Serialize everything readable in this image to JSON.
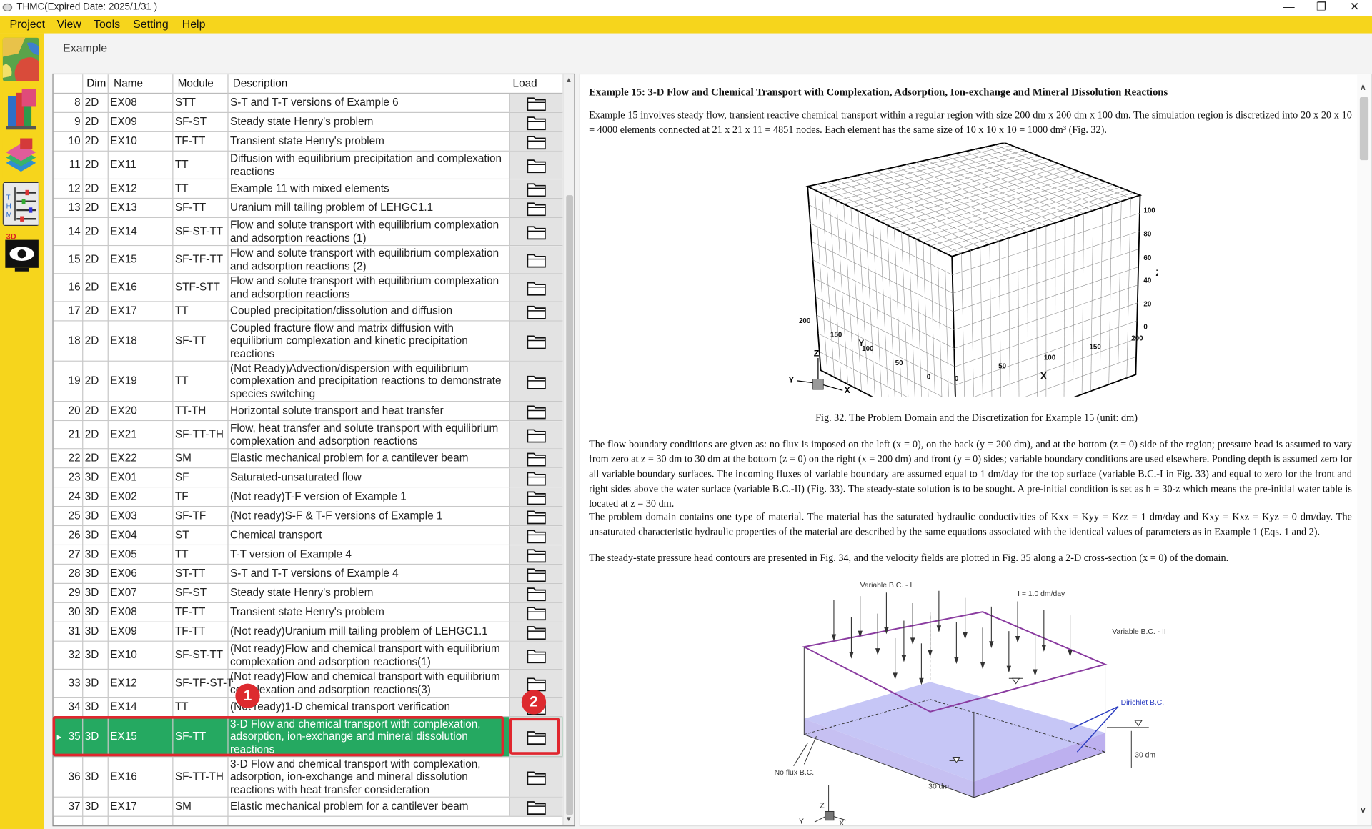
{
  "window": {
    "title": "THMC(Expired Date: 2025/1/31 )"
  },
  "menu": [
    "Project",
    "View",
    "Tools",
    "Setting",
    "Help"
  ],
  "toolbar": [
    "map-tool-icon",
    "books-tool-icon",
    "3d-layers-tool-icon",
    "thmc-panel-tool-icon",
    "3d-viewer-tool-icon"
  ],
  "tab": {
    "label": "Example"
  },
  "grid": {
    "columns": [
      "Dim",
      "Name",
      "Module",
      "Description",
      "Load"
    ],
    "rows": [
      {
        "n": "8",
        "dim": "2D",
        "name": "EX08",
        "module": "STT",
        "desc": "S-T and T-T versions of Example 6"
      },
      {
        "n": "9",
        "dim": "2D",
        "name": "EX09",
        "module": "SF-ST",
        "desc": "Steady state Henry's problem"
      },
      {
        "n": "10",
        "dim": "2D",
        "name": "EX10",
        "module": "TF-TT",
        "desc": "Transient state Henry's problem"
      },
      {
        "n": "11",
        "dim": "2D",
        "name": "EX11",
        "module": "TT",
        "desc": "Diffusion with equilibrium precipitation and complexation reactions"
      },
      {
        "n": "12",
        "dim": "2D",
        "name": "EX12",
        "module": "TT",
        "desc": "Example 11 with mixed elements"
      },
      {
        "n": "13",
        "dim": "2D",
        "name": "EX13",
        "module": "SF-TT",
        "desc": "Uranium mill tailing problem of LEHGC1.1"
      },
      {
        "n": "14",
        "dim": "2D",
        "name": "EX14",
        "module": "SF-ST-TT",
        "desc": "Flow and solute transport with equilibrium complexation and adsorption reactions (1)"
      },
      {
        "n": "15",
        "dim": "2D",
        "name": "EX15",
        "module": "SF-TF-TT",
        "desc": "Flow and solute transport with equilibrium complexation and adsorption reactions (2)"
      },
      {
        "n": "16",
        "dim": "2D",
        "name": "EX16",
        "module": "STF-STT",
        "desc": "Flow and solute transport with equilibrium complexation and adsorption reactions"
      },
      {
        "n": "17",
        "dim": "2D",
        "name": "EX17",
        "module": "TT",
        "desc": "Coupled precipitation/dissolution and diffusion"
      },
      {
        "n": "18",
        "dim": "2D",
        "name": "EX18",
        "module": "SF-TT",
        "desc": "Coupled fracture flow and matrix diffusion with equilibrium complexation and kinetic precipitation reactions"
      },
      {
        "n": "19",
        "dim": "2D",
        "name": "EX19",
        "module": "TT",
        "desc": "(Not Ready)Advection/dispersion with equilibrium complexation and precipitation reactions to demonstrate species switching"
      },
      {
        "n": "20",
        "dim": "2D",
        "name": "EX20",
        "module": "TT-TH",
        "desc": "Horizontal solute transport and heat transfer"
      },
      {
        "n": "21",
        "dim": "2D",
        "name": "EX21",
        "module": "SF-TT-TH",
        "desc": "Flow, heat transfer and solute transport with equilibrium complexation and adsorption reactions"
      },
      {
        "n": "22",
        "dim": "2D",
        "name": "EX22",
        "module": "SM",
        "desc": "Elastic mechanical problem for a cantilever beam"
      },
      {
        "n": "23",
        "dim": "3D",
        "name": "EX01",
        "module": "SF",
        "desc": "Saturated-unsaturated flow"
      },
      {
        "n": "24",
        "dim": "3D",
        "name": "EX02",
        "module": "TF",
        "desc": "(Not ready)T-F version of Example 1"
      },
      {
        "n": "25",
        "dim": "3D",
        "name": "EX03",
        "module": "SF-TF",
        "desc": "(Not ready)S-F & T-F versions of Example 1"
      },
      {
        "n": "26",
        "dim": "3D",
        "name": "EX04",
        "module": "ST",
        "desc": "Chemical transport"
      },
      {
        "n": "27",
        "dim": "3D",
        "name": "EX05",
        "module": "TT",
        "desc": "T-T version of Example 4"
      },
      {
        "n": "28",
        "dim": "3D",
        "name": "EX06",
        "module": "ST-TT",
        "desc": "S-T and T-T versions of Example 4"
      },
      {
        "n": "29",
        "dim": "3D",
        "name": "EX07",
        "module": "SF-ST",
        "desc": "Steady state Henry's problem"
      },
      {
        "n": "30",
        "dim": "3D",
        "name": "EX08",
        "module": "TF-TT",
        "desc": "Transient state Henry's problem"
      },
      {
        "n": "31",
        "dim": "3D",
        "name": "EX09",
        "module": "TF-TT",
        "desc": "(Not ready)Uranium mill tailing problem of LEHGC1.1"
      },
      {
        "n": "32",
        "dim": "3D",
        "name": "EX10",
        "module": "SF-ST-TT",
        "desc": "(Not ready)Flow and chemical transport with equilibrium complexation and adsorption reactions(1)"
      },
      {
        "n": "33",
        "dim": "3D",
        "name": "EX12",
        "module": "SF-TF-ST-T",
        "desc": "(Not ready)Flow and chemical transport with equilibrium complexation and adsorption reactions(3)"
      },
      {
        "n": "34",
        "dim": "3D",
        "name": "EX14",
        "module": "TT",
        "desc": "(Not ready)1-D chemical transport verification"
      },
      {
        "n": "35",
        "dim": "3D",
        "name": "EX15",
        "module": "SF-TT",
        "desc": "3-D Flow and chemical transport with complexation, adsorption, ion-exchange and mineral dissolution reactions"
      },
      {
        "n": "36",
        "dim": "3D",
        "name": "EX16",
        "module": "SF-TT-TH",
        "desc": "3-D Flow and chemical transport with complexation, adsorption, ion-exchange and mineral dissolution reactions with heat transfer consideration"
      },
      {
        "n": "37",
        "dim": "3D",
        "name": "EX17",
        "module": "SM",
        "desc": "Elastic mechanical problem for a cantilever beam"
      }
    ],
    "selected_index": 27
  },
  "annotations": {
    "badge1": "1",
    "badge2": "2"
  },
  "doc": {
    "heading": "Example 15:  3-D Flow and Chemical Transport with Complexation, Adsorption, Ion-exchange and Mineral Dissolution Reactions",
    "para1": "Example 15 involves steady flow, transient reactive chemical transport within a regular region with size 200 dm x 200 dm x 100 dm.  The simulation region is discretized into 20 x 20 x 10 = 4000 elements connected at 21 x 21 x 11 = 4851 nodes.  Each element has the same size of 10 x 10 x 10 = 1000 dm³ (Fig. 32).",
    "fig32": {
      "z_ticks": [
        "100",
        "80",
        "60",
        "40",
        "20",
        "0"
      ],
      "y_ticks": [
        "200",
        "150",
        "100",
        "50",
        "0"
      ],
      "x_ticks": [
        "0",
        "50",
        "100",
        "150",
        "200"
      ],
      "axis_z": "Z",
      "axis_y": "Y",
      "axis_x": "X"
    },
    "caption32": "Fig. 32. The Problem Domain and the Discretization for Example 15 (unit: dm)",
    "para2": "The flow boundary conditions are given as: no flux is imposed on the left (x = 0), on the back (y = 200 dm), and at the bottom (z = 0) side of the region; pressure head is assumed to vary from zero at z = 30 dm to 30 dm at the bottom (z = 0) on the right (x = 200 dm) and front (y = 0) sides; variable boundary conditions are used elsewhere.  Ponding depth is assumed zero for all variable boundary surfaces.  The incoming fluxes of variable boundary are assumed equal to 1 dm/day for the top surface (variable B.C.-I in Fig. 33) and equal to zero for the front and right sides above the water surface (variable B.C.-II) (Fig. 33).  The steady-state solution is to be sought.  A pre-initial condition is set as h = 30-z which means the pre-initial water table is located at z = 30 dm.",
    "para3": "The problem domain contains one type of material. The material has the saturated hydraulic conductivities of Kxx = Kyy = Kzz = 1 dm/day and Kxy = Kxz = Kyz = 0 dm/day. The unsaturated characteristic hydraulic properties of the material are described by the same equations associated with the identical values of parameters as in Example 1 (Eqs. 1 and 2).",
    "para4": "The steady-state pressure head contours are presented in Fig. 34, and the velocity fields are plotted in Fig. 35 along a 2-D cross-section (x = 0) of the domain.",
    "fig33": {
      "var_bc1": "Variable B.C. - I",
      "flux": "I = 1.0 dm/day",
      "var_bc2": "Variable B.C. - II",
      "dirichlet": "Dirichlet B.C.",
      "dim_right": "30 dm",
      "dim_front": "30 dm",
      "no_flux": "No flux B.C.",
      "axis_z": "Z",
      "axis_y": "Y",
      "axis_x": "X"
    }
  }
}
